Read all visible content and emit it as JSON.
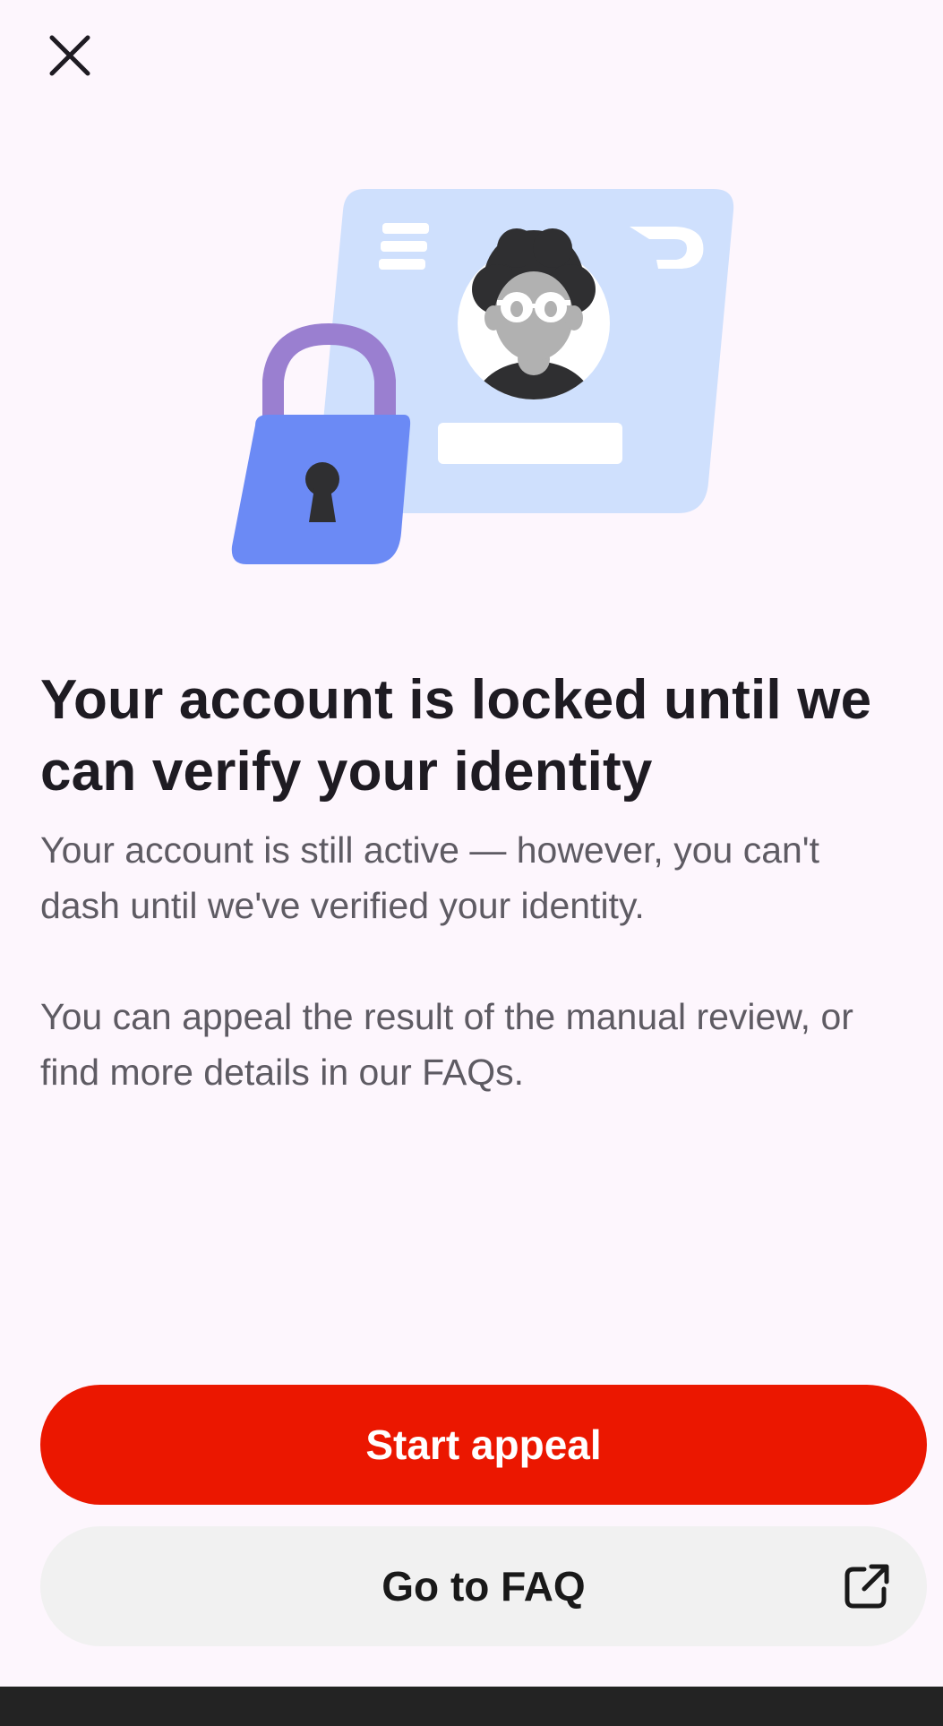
{
  "header": {
    "close_icon": "close-icon"
  },
  "illustration": {
    "icons": [
      "lock-icon",
      "id-card-icon",
      "avatar-icon",
      "doordash-logo-icon"
    ],
    "colors": {
      "card": "#cfe0fd",
      "lock_body": "#6b8af5",
      "lock_shackle": "#9a7fd0"
    }
  },
  "content": {
    "title": "Your account is locked until we can verify your identity",
    "paragraph_1": "Your account is still active — however, you can't dash until we've verified your identity.",
    "paragraph_2": "You can appeal the result of the manual review, or find more details in our FAQs."
  },
  "actions": {
    "primary_label": "Start appeal",
    "secondary_label": "Go to FAQ",
    "secondary_icon": "external-link-icon"
  },
  "colors": {
    "background": "#fdf6fd",
    "primary": "#eb1700",
    "secondary_bg": "#f1f1f1",
    "heading": "#1e1b22",
    "body": "#5e5b63"
  }
}
